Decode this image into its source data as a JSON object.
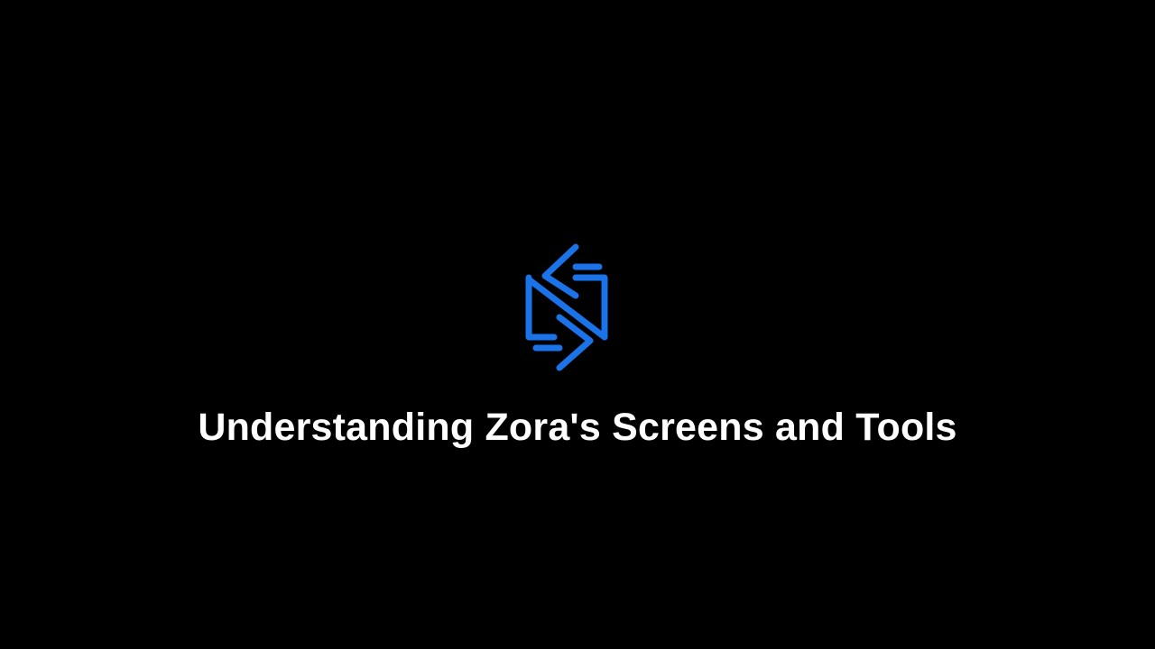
{
  "intro": {
    "title": "Understanding Zora's Screens and Tools",
    "logo_icon": "zora-logo-icon",
    "logo_color": "#1a73e8",
    "background_color": "#000000",
    "title_color": "#ffffff"
  }
}
